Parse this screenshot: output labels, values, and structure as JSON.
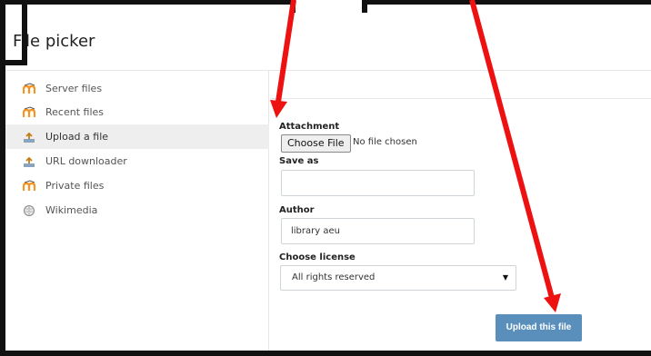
{
  "dialog": {
    "title": "File picker"
  },
  "sidebar": {
    "items": [
      {
        "label": "Server files",
        "icon": "moodle-icon",
        "active": false
      },
      {
        "label": "Recent files",
        "icon": "moodle-icon",
        "active": false
      },
      {
        "label": "Upload a file",
        "icon": "upload-icon",
        "active": true
      },
      {
        "label": "URL downloader",
        "icon": "upload-icon",
        "active": false
      },
      {
        "label": "Private files",
        "icon": "moodle-icon",
        "active": false
      },
      {
        "label": "Wikimedia",
        "icon": "wikimedia-icon",
        "active": false
      }
    ]
  },
  "form": {
    "attachment_label": "Attachment",
    "choose_file_label": "Choose File",
    "file_status": "No file chosen",
    "save_as_label": "Save as",
    "save_as_value": "",
    "author_label": "Author",
    "author_value": "library aeu",
    "license_label": "Choose license",
    "license_value": "All rights reserved",
    "upload_button": "Upload this file"
  },
  "colors": {
    "accent": "#5a8fbc",
    "active_row": "#eeeeee",
    "annotation_arrow": "#ee1111",
    "moodle_orange": "#f7931e"
  }
}
